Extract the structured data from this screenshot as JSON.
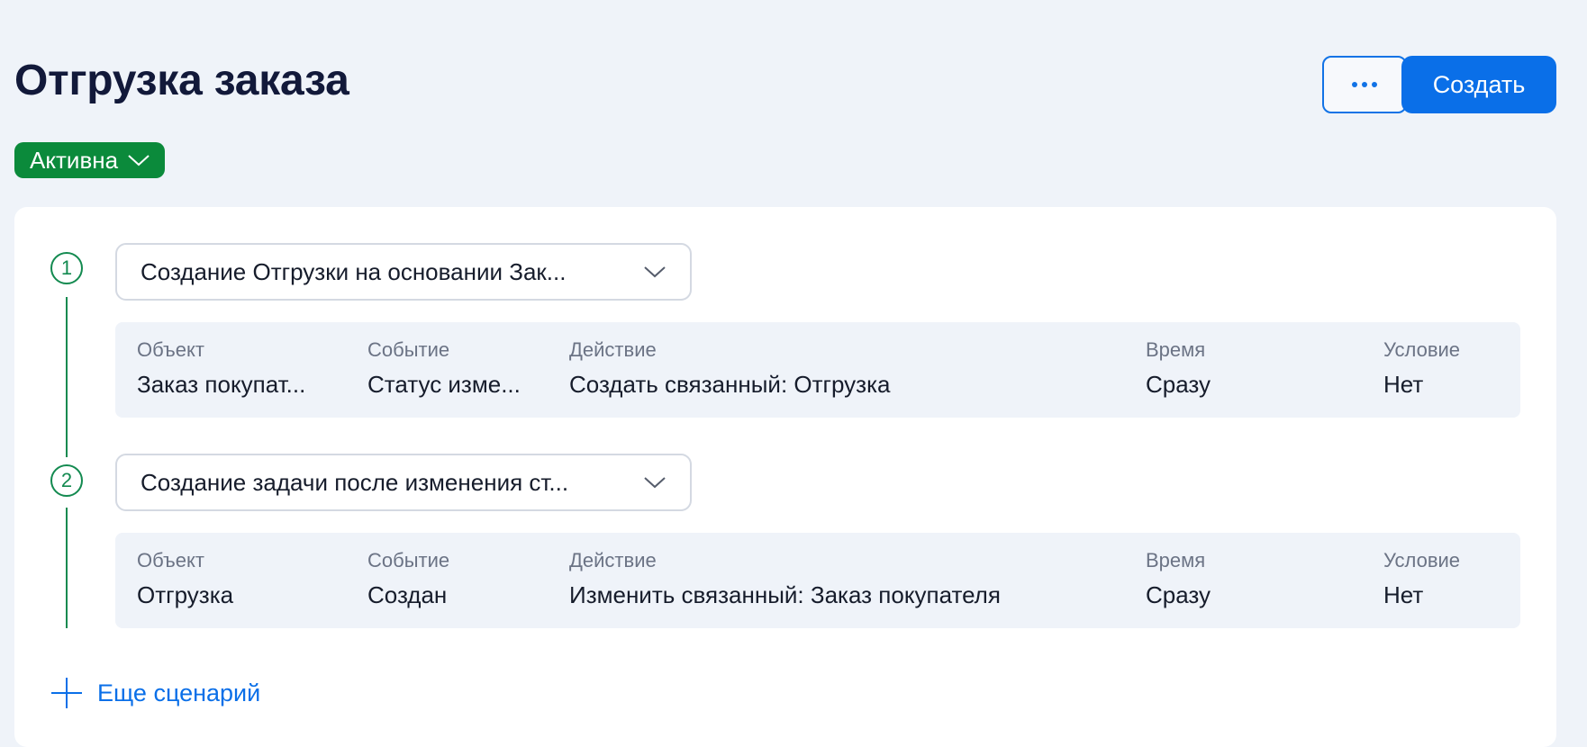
{
  "header": {
    "title": "Отгрузка заказа",
    "more_icon": "ellipsis-icon",
    "create_label": "Создать"
  },
  "status": {
    "label": "Активна",
    "color": "#0b8a3b"
  },
  "colors": {
    "accent": "#0a6fe8",
    "step": "#138a50",
    "background": "#eff3f9"
  },
  "scenarios": [
    {
      "number": "1",
      "title": "Создание Отгрузки на основании Зак...",
      "details": {
        "object_label": "Объект",
        "object_value": "Заказ покупат...",
        "event_label": "Событие",
        "event_value": "Статус изме...",
        "action_label": "Действие",
        "action_value": "Создать связанный: Отгрузка",
        "time_label": "Время",
        "time_value": "Сразу",
        "condition_label": "Условие",
        "condition_value": "Нет"
      }
    },
    {
      "number": "2",
      "title": "Создание задачи после изменения ст...",
      "details": {
        "object_label": "Объект",
        "object_value": "Отгрузка",
        "event_label": "Событие",
        "event_value": "Создан",
        "action_label": "Действие",
        "action_value": "Изменить связанный: Заказ покупателя",
        "time_label": "Время",
        "time_value": "Сразу",
        "condition_label": "Условие",
        "condition_value": "Нет"
      }
    }
  ],
  "add_scenario": {
    "label": "Еще сценарий",
    "icon": "plus-icon"
  }
}
